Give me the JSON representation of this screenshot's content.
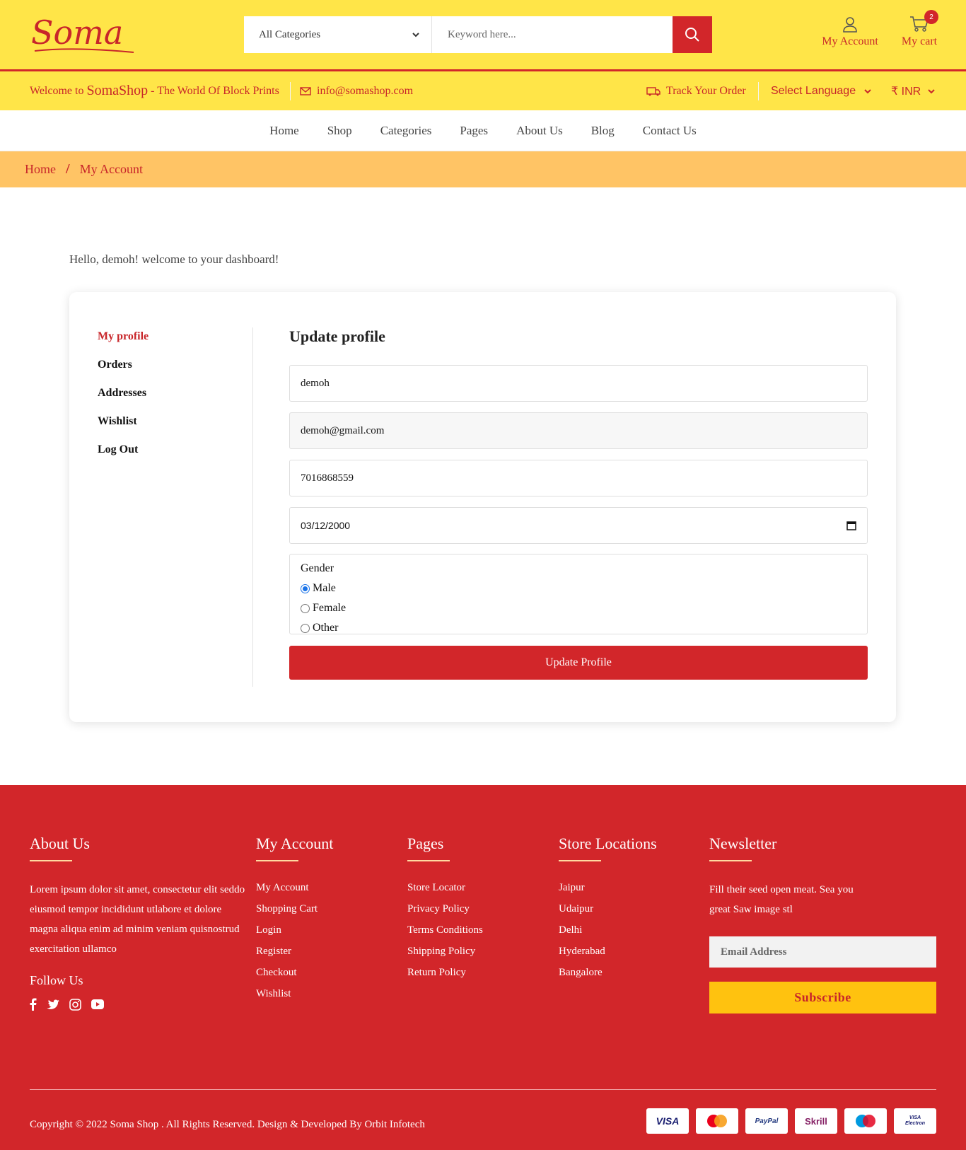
{
  "header": {
    "logo_text": "Soma",
    "category_select": "All Categories",
    "search_placeholder": "Keyword here...",
    "account_label": "My Account",
    "cart_label": "My cart",
    "cart_count": "2"
  },
  "subbar": {
    "welcome_prefix": "Welcome to ",
    "welcome_brand": "SomaShop",
    "welcome_suffix": " - The World Of Block Prints",
    "email": "info@somashop.com",
    "track_order": "Track Your Order",
    "language": "Select Language",
    "currency": "₹ INR"
  },
  "nav": [
    "Home",
    "Shop",
    "Categories",
    "Pages",
    "About Us",
    "Blog",
    "Contact Us"
  ],
  "breadcrumb": {
    "home": "Home",
    "current": "My Account"
  },
  "dashboard": {
    "greeting": "Hello, demoh! welcome to your dashboard!",
    "menu": [
      "My profile",
      "Orders",
      "Addresses",
      "Wishlist",
      "Log Out"
    ],
    "form_title": "Update profile",
    "name_value": "demoh",
    "email_value": "demoh@gmail.com",
    "phone_value": "7016868559",
    "dob_value": "03/12/2000",
    "gender_label": "Gender",
    "gender_options": [
      "Male",
      "Female",
      "Other"
    ],
    "gender_selected": "Male",
    "update_button": "Update Profile"
  },
  "footer": {
    "about": {
      "title": "About Us",
      "text1": "Lorem ipsum dolor sit amet, consectetur elit seddo eiusmod tempor incididunt utlabore et dolore",
      "text2": "magna aliqua enim ad minim veniam quisnostrud exercitation ullamco",
      "follow": "Follow Us"
    },
    "account": {
      "title": "My Account",
      "links": [
        "My Account",
        "Shopping Cart",
        "Login",
        "Register",
        "Checkout",
        "Wishlist"
      ]
    },
    "pages": {
      "title": "Pages",
      "links": [
        "Store Locator",
        "Privacy Policy",
        "Terms Conditions",
        "Shipping Policy",
        "Return Policy"
      ]
    },
    "stores": {
      "title": "Store Locations",
      "links": [
        "Jaipur",
        "Udaipur",
        "Delhi",
        "Hyderabad",
        "Bangalore"
      ]
    },
    "newsletter": {
      "title": "Newsletter",
      "text": "Fill their seed open meat. Sea you great Saw image stl",
      "placeholder": "Email Address",
      "button": "Subscribe"
    },
    "copyright": "Copyright © 2022 Soma Shop . All Rights Reserved. Design & Developed By Orbit Infotech",
    "payments": [
      "VISA",
      "MasterCard",
      "PayPal",
      "Skrill",
      "Maestro",
      "VISA Electron"
    ]
  },
  "colors": {
    "brand_red": "#d2262a",
    "header_yellow": "#ffe548",
    "breadcrumb_orange": "#ffc465",
    "subscribe_yellow": "#ffc20f"
  }
}
